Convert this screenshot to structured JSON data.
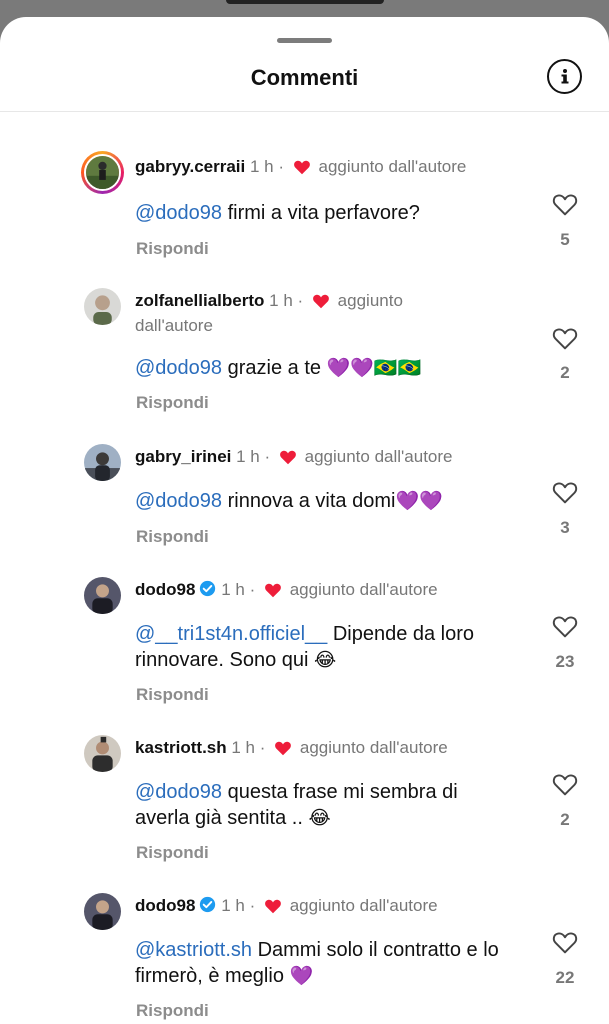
{
  "header": {
    "title": "Commenti",
    "info_icon": "info-icon"
  },
  "comments": [
    {
      "username": "gabryy.cerraii",
      "time": "1 h",
      "separator": "·",
      "badge": "aggiunto dall'autore",
      "mention": "@dodo98",
      "text": " firmi a vita perfavore?",
      "reply": "Rispondi",
      "likes": "5"
    },
    {
      "username": "zolfanellialberto",
      "time": "1 h",
      "separator": "·",
      "badge": "aggiunto",
      "badge2": "dall'autore",
      "mention": "@dodo98",
      "text": " grazie a te ",
      "emojis": "💜💜🇧🇷🇧🇷",
      "reply": "Rispondi",
      "likes": "2"
    },
    {
      "username": "gabry_irinei",
      "time": "1 h",
      "separator": "·",
      "badge": "aggiunto dall'autore",
      "mention": "@dodo98",
      "text": " rinnova a vita domi",
      "emojis": "💜💜",
      "reply": "Rispondi",
      "likes": "3"
    },
    {
      "username": "dodo98",
      "time": "1 h",
      "separator": "·",
      "badge": "aggiunto dall'autore",
      "mention": "@__tri1st4n.officiel__",
      "text": " Dipende da loro rinnovare. Sono qui ",
      "emojis": "😂",
      "reply": "Rispondi",
      "likes": "23"
    },
    {
      "username": "kastriott.sh",
      "time": "1 h",
      "separator": "·",
      "badge": "aggiunto dall'autore",
      "mention": "@dodo98",
      "text": " questa frase mi sembra di averla già sentita .. ",
      "emojis": "😂",
      "reply": "Rispondi",
      "likes": "2"
    },
    {
      "username": "dodo98",
      "time": "1 h",
      "separator": "·",
      "badge": "aggiunto dall'autore",
      "mention": "@kastriott.sh",
      "text": " Dammi solo il contratto e lo firmerò, è meglio ",
      "emojis": "💜",
      "reply": "Rispondi",
      "likes": "22"
    }
  ],
  "colors": {
    "heart": "#ee1d3a",
    "mention": "#2b6dbc",
    "verified": "#1d9bf0",
    "muted": "#777777"
  }
}
